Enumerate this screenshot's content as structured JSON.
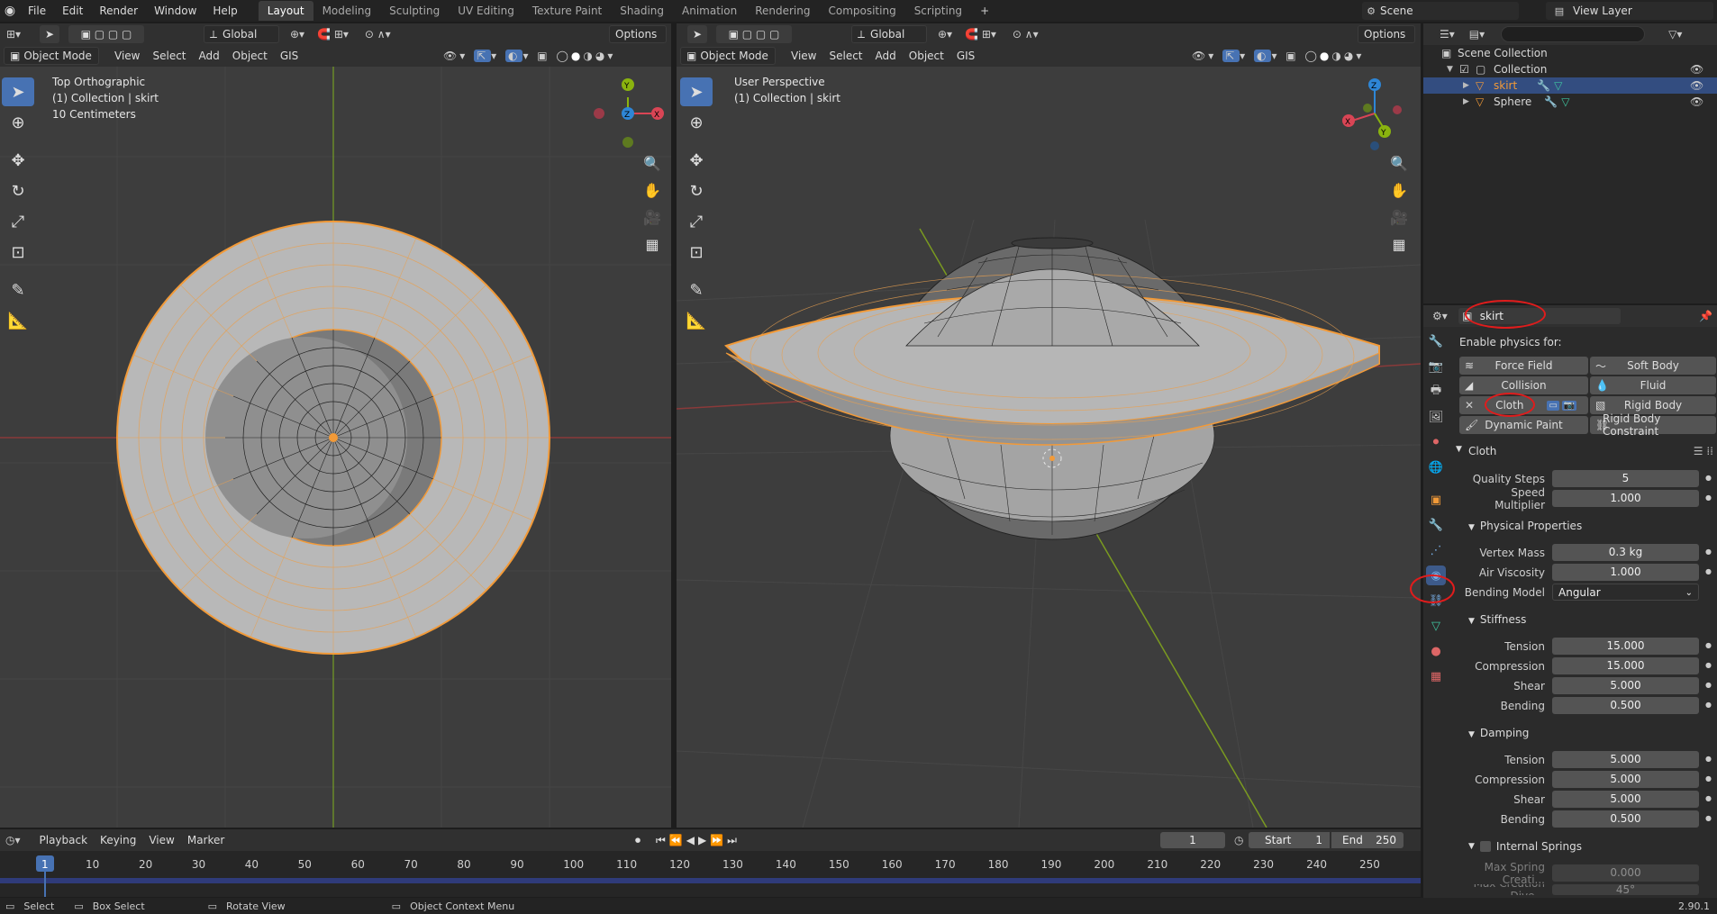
{
  "topbar": {
    "menus": [
      "File",
      "Edit",
      "Render",
      "Window",
      "Help"
    ],
    "workspaces": [
      "Layout",
      "Modeling",
      "Sculpting",
      "UV Editing",
      "Texture Paint",
      "Shading",
      "Animation",
      "Rendering",
      "Compositing",
      "Scripting"
    ],
    "active_workspace": "Layout",
    "add_tab": "+",
    "scene": "Scene",
    "view_layer": "View Layer"
  },
  "left_vp": {
    "transform": "Global",
    "options": "Options",
    "mode": "Object Mode",
    "menus": [
      "View",
      "Select",
      "Add",
      "Object",
      "GIS"
    ],
    "info": [
      "Top Orthographic",
      "(1) Collection | skirt",
      "10 Centimeters"
    ]
  },
  "right_vp": {
    "transform": "Global",
    "options": "Options",
    "mode": "Object Mode",
    "menus": [
      "View",
      "Select",
      "Add",
      "Object",
      "GIS"
    ],
    "info": [
      "User Perspective",
      "(1) Collection | skirt"
    ]
  },
  "gizmo": {
    "x": "X",
    "y": "Y",
    "z": "Z"
  },
  "outliner": {
    "search_placeholder": "",
    "items": [
      {
        "label": "Scene Collection"
      },
      {
        "label": "Collection"
      },
      {
        "label": "skirt"
      },
      {
        "label": "Sphere"
      }
    ]
  },
  "properties": {
    "object_name": "skirt",
    "enable_physics": "Enable physics for:",
    "buttons": {
      "force_field": "Force Field",
      "soft_body": "Soft Body",
      "collision": "Collision",
      "fluid": "Fluid",
      "cloth": "Cloth",
      "rigid_body": "Rigid Body",
      "dynamic_paint": "Dynamic Paint",
      "rigid_body_constraint": "Rigid Body Constraint"
    },
    "cloth_header": "Cloth",
    "quality_steps": {
      "label": "Quality Steps",
      "value": "5"
    },
    "speed_multiplier": {
      "label": "Speed Multiplier",
      "value": "1.000"
    },
    "physical_properties": "Physical Properties",
    "vertex_mass": {
      "label": "Vertex Mass",
      "value": "0.3 kg"
    },
    "air_viscosity": {
      "label": "Air Viscosity",
      "value": "1.000"
    },
    "bending_model": {
      "label": "Bending Model",
      "value": "Angular"
    },
    "stiffness": "Stiffness",
    "stiff_tension": {
      "label": "Tension",
      "value": "15.000"
    },
    "stiff_compression": {
      "label": "Compression",
      "value": "15.000"
    },
    "stiff_shear": {
      "label": "Shear",
      "value": "5.000"
    },
    "stiff_bending": {
      "label": "Bending",
      "value": "0.500"
    },
    "damping": "Damping",
    "damp_tension": {
      "label": "Tension",
      "value": "5.000"
    },
    "damp_compression": {
      "label": "Compression",
      "value": "5.000"
    },
    "damp_shear": {
      "label": "Shear",
      "value": "5.000"
    },
    "damp_bending": {
      "label": "Bending",
      "value": "0.500"
    },
    "internal_springs": "Internal Springs",
    "max_spring": {
      "label": "Max Spring Creati...",
      "value": "0.000"
    },
    "max_creation": {
      "label": "Max Creation Dive...",
      "value": "45°"
    }
  },
  "timeline": {
    "menus": [
      "Playback",
      "Keying",
      "View",
      "Marker"
    ],
    "current_frame": "1",
    "start_label": "Start",
    "start": "1",
    "end_label": "End",
    "end": "250",
    "ticks": [
      "1",
      "10",
      "20",
      "30",
      "40",
      "50",
      "60",
      "70",
      "80",
      "90",
      "100",
      "110",
      "120",
      "130",
      "140",
      "150",
      "160",
      "170",
      "180",
      "190",
      "200",
      "210",
      "220",
      "230",
      "240",
      "250"
    ]
  },
  "statusbar": {
    "select": "Select",
    "box_select": "Box Select",
    "rotate_view": "Rotate View",
    "context_menu": "Object Context Menu",
    "version": "2.90.1"
  },
  "colors": {
    "accent": "#4772b3",
    "selection": "#f29a38",
    "annotation": "#e01c1c"
  }
}
